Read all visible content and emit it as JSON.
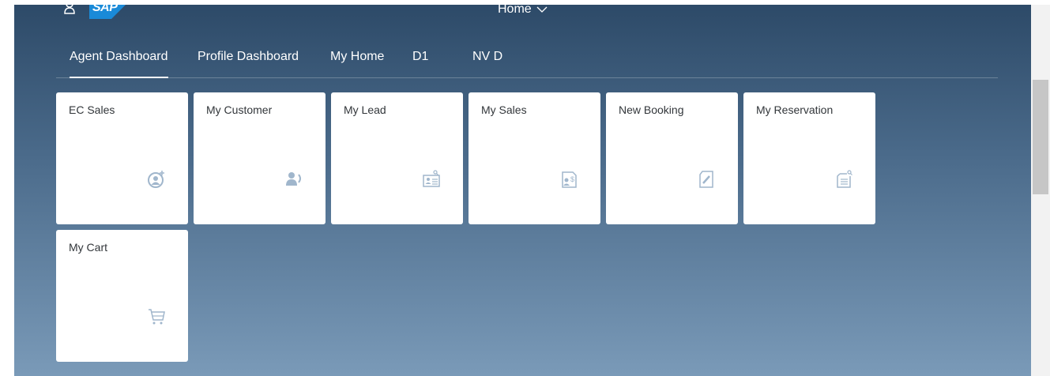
{
  "header": {
    "brand": "SAP",
    "home_menu_label": "Home",
    "user_icon": "user-icon",
    "home_menu_icon": "chevron-down-icon"
  },
  "tabs": [
    {
      "label": "Agent Dashboard",
      "active": true
    },
    {
      "label": "Profile Dashboard",
      "active": false
    },
    {
      "label": "My Home",
      "active": false
    },
    {
      "label": "D1",
      "active": false
    },
    {
      "label": "NV D",
      "active": false
    }
  ],
  "tiles": [
    {
      "title": "EC Sales",
      "icon": "customer-add-icon"
    },
    {
      "title": "My Customer",
      "icon": "customer-contact-icon"
    },
    {
      "title": "My Lead",
      "icon": "business-card-search-icon"
    },
    {
      "title": "My Sales",
      "icon": "sales-document-icon"
    },
    {
      "title": "New Booking",
      "icon": "document-edit-icon"
    },
    {
      "title": "My Reservation",
      "icon": "list-search-icon"
    },
    {
      "title": "My Cart",
      "icon": "cart-icon"
    }
  ],
  "colors": {
    "shell_top": "#2d4a68",
    "shell_bottom": "#7a9ab8",
    "tile_icon": "#a0b6cc",
    "tile_title": "#32363a",
    "logo_blue": "#1a8ad8"
  }
}
